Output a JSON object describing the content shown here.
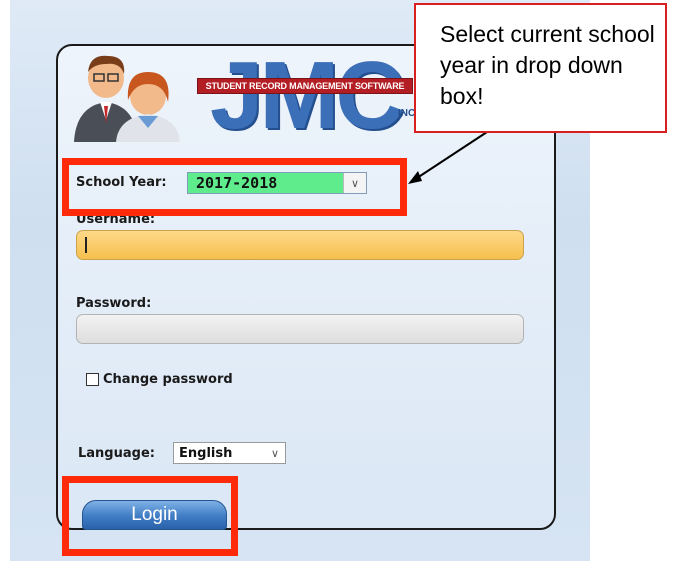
{
  "header": {
    "logo_text": "JMC",
    "logo_tagline": "STUDENT RECORD MANAGEMENT SOFTWARE",
    "logo_suffix": "INC"
  },
  "form": {
    "school_year_label": "School Year:",
    "school_year_value": "2017-2018",
    "username_label": "Username:",
    "username_value": "",
    "password_label": "Password:",
    "password_value": "",
    "change_password_label": "Change password",
    "change_password_checked": false,
    "language_label": "Language:",
    "language_value": "English",
    "login_label": "Login"
  },
  "annotation": {
    "callout_text": "Select current school year in drop down box!",
    "highlight_color": "#ff2a0a"
  },
  "colors": {
    "year_select_bg": "#5fec8c",
    "username_bg": "#f5c04d",
    "login_button": "#3f7cc4"
  }
}
